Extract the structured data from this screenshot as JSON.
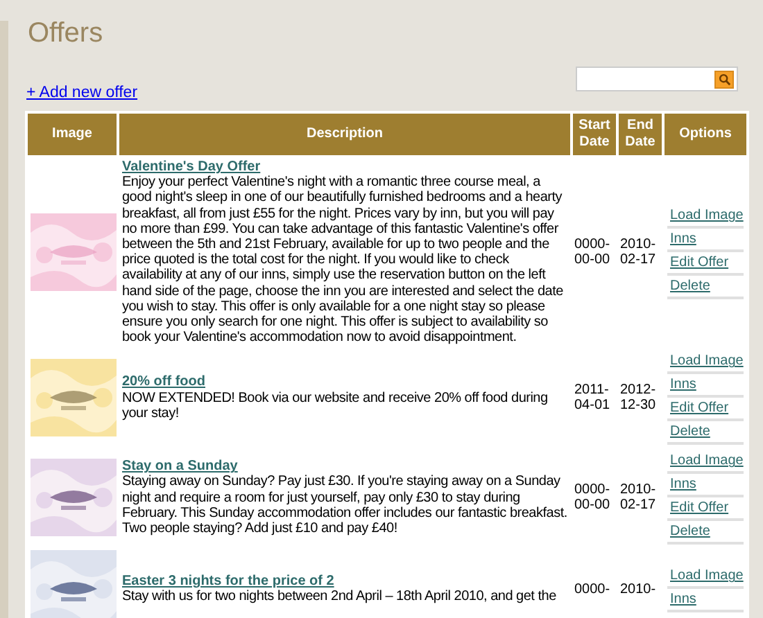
{
  "page_title": "Offers",
  "add_link": "+ Add new offer",
  "table": {
    "columns": [
      "Image",
      "Description",
      "Start Date",
      "End Date",
      "Options"
    ],
    "rows": [
      {
        "image": {
          "kind": "picture"
        },
        "title": "Valentine's Day Offer",
        "description": "Enjoy your perfect Valentine's night with a romantic three course meal, a good night's sleep in one of our beautifully furnished bedrooms and a hearty breakfast, all from just £55 for the night. Prices vary by inn, but you will pay no more than £99. You can take advantage of this fantastic Valentine's offer between the 5th and 21st February, available for up to two people and the price quoted is the total cost for the night. If you would like to check availability at any of our inns, simply use the reservation button on the left hand side of the page, choose the inn you are interested and select the date you wish to stay. This offer is only available for a one night stay so please ensure you only search for one night. This offer is subject to availability so book your Valentine's accommodation now to avoid disappointment.",
        "start": "0000-00-00",
        "end": "2010-02-17",
        "options": [
          "Load Image",
          "Inns",
          "Edit Offer",
          "Delete"
        ]
      },
      {
        "image": {
          "kind": "picture"
        },
        "title": "20% off food",
        "description": "NOW EXTENDED! Book via our website and receive 20% off food during your stay!",
        "start": "2011-04-01",
        "end": "2012-12-30",
        "options": [
          "Load Image",
          "Inns",
          "Edit Offer",
          "Delete"
        ]
      },
      {
        "image": {
          "kind": "picture"
        },
        "title": "Stay on a Sunday",
        "description": "Staying away on Sunday? Pay just £30. If you're staying away on a Sunday night and require a room for just yourself, pay only £30 to stay during February. This Sunday accommodation offer includes our fantastic breakfast. Two people staying? Add just £10 and pay £40!",
        "start": "0000-00-00",
        "end": "2010-02-17",
        "options": [
          "Load Image",
          "Inns",
          "Edit Offer",
          "Delete"
        ]
      },
      {
        "image": {
          "kind": "picture"
        },
        "title": "Easter 3 nights for the price of 2",
        "description": "Stay with us for two nights between 2nd April – 18th April 2010, and get the",
        "start": "0000-",
        "end": "2010-",
        "options": [
          "Load Image",
          "Inns"
        ]
      }
    ]
  }
}
